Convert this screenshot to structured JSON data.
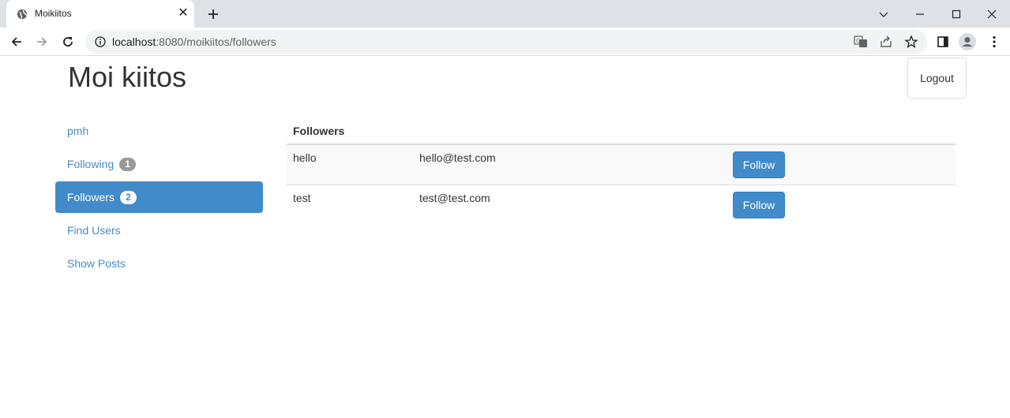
{
  "browser": {
    "tab_title": "Moikiitos",
    "url_host": "localhost",
    "url_path": ":8080/moikiitos/followers"
  },
  "header": {
    "brand": "Moi kiitos",
    "logout_label": "Logout"
  },
  "sidebar": {
    "items": [
      {
        "label": "pmh"
      },
      {
        "label": "Following",
        "badge": "1"
      },
      {
        "label": "Followers",
        "badge": "2"
      },
      {
        "label": "Find Users"
      },
      {
        "label": "Show Posts"
      }
    ]
  },
  "table": {
    "header": "Followers",
    "rows": [
      {
        "name": "hello",
        "email": "hello@test.com",
        "action": "Follow"
      },
      {
        "name": "test",
        "email": "test@test.com",
        "action": "Follow"
      }
    ]
  },
  "colors": {
    "primary": "#428bca",
    "badge_gray": "#999999",
    "chrome_bg": "#dee1e6"
  },
  "icons": [
    "globe-icon",
    "close-icon",
    "plus-icon",
    "chevron-down-icon",
    "minimize-icon",
    "maximize-icon",
    "window-close-icon",
    "back-icon",
    "forward-icon",
    "reload-icon",
    "info-icon",
    "translate-icon",
    "share-icon",
    "star-icon",
    "side-panel-icon",
    "profile-icon",
    "menu-icon"
  ]
}
